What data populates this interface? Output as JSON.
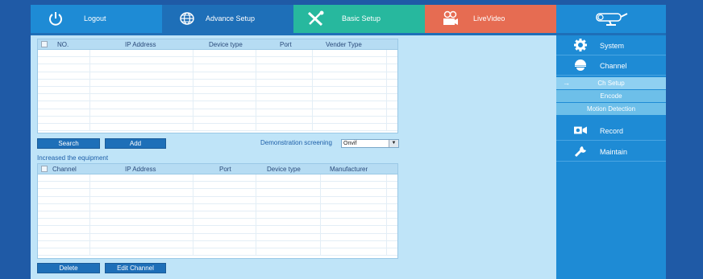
{
  "topbar": {
    "tabs": [
      {
        "label": "Logout",
        "icon": "power-icon"
      },
      {
        "label": "Advance Setup",
        "icon": "globe-icon"
      },
      {
        "label": "Basic Setup",
        "icon": "tools-icon"
      },
      {
        "label": "LiveVideo",
        "icon": "camera-icon"
      }
    ],
    "logo_icon": "cctv-camera-logo-icon"
  },
  "device_table": {
    "columns": [
      "NO.",
      "IP Address",
      "Device type",
      "Port",
      "Vender Type"
    ],
    "rows": []
  },
  "buttons": {
    "search": "Search",
    "add": "Add",
    "delete": "Delete",
    "edit_channel": "Edit Channel"
  },
  "demo": {
    "label": "Demonstration screening",
    "value": "Onvif"
  },
  "increased": {
    "label": "Increased the equipment",
    "columns": [
      "Channel",
      "IP Address",
      "Port",
      "Device type",
      "Manufacturer"
    ],
    "rows": []
  },
  "sidebar": {
    "items": [
      {
        "label": "System",
        "icon": "gear-icon"
      },
      {
        "label": "Channel",
        "icon": "dome-camera-icon"
      },
      {
        "label": "Record",
        "icon": "video-camera-icon"
      },
      {
        "label": "Maintain",
        "icon": "wrench-icon"
      }
    ],
    "channel_sub": [
      "Ch Setup",
      "Encode",
      "Motion Detection"
    ],
    "active_sub": "Ch Setup"
  },
  "colors": {
    "background": "#1f5aa6",
    "panel": "#bfe4f8",
    "logout_tab": "#1e8bd5",
    "advance_tab": "#1e6fb8",
    "basic_tab": "#27b89e",
    "live_tab": "#e66c52",
    "sidebar": "#1e8bd5"
  }
}
